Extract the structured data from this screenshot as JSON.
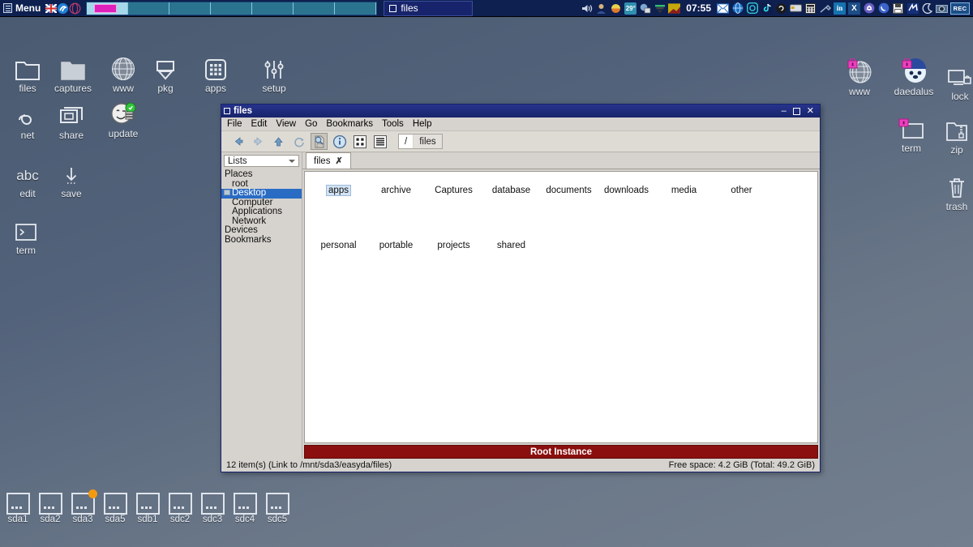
{
  "taskbar": {
    "menu_label": "Menu",
    "menu_icon": "menu-list-icon",
    "flag_icon": "uk-flag-icon",
    "browser_icon": "browser-globe-icon",
    "rings_icon": "rings-icon",
    "pager": {
      "cells": 7,
      "active_index": 0
    },
    "tasks": [
      {
        "label": "files",
        "icon": "window-square-icon",
        "active": true
      }
    ],
    "clock": "07:55",
    "tray_icons": [
      "volume-icon",
      "user-icon",
      "weather-sun-icon",
      "temperature-29-icon",
      "network-icon",
      "printer-icon",
      "disk-usage-icon"
    ],
    "tray_icons_right": [
      "mail-envelope-icon",
      "globe-browser-icon",
      "instagram-icon",
      "tiktok-icon",
      "amazon-icon",
      "card-icon",
      "calculator-icon",
      "tools-icon",
      "linkedin-icon",
      "x-twitter-icon",
      "openai-icon",
      "whatsapp-icon",
      "floppy-save-icon",
      "update-arrows-icon",
      "sleep-moon-icon",
      "camera-icon",
      "rec-icon"
    ],
    "temp_label": "29°",
    "rec_label": "REC"
  },
  "desktop_left": [
    {
      "label": "files",
      "icon": "folder-outline-icon"
    },
    {
      "label": "captures",
      "icon": "folder-filled-icon"
    },
    {
      "label": "www",
      "icon": "globe-sphere-icon"
    },
    {
      "label": "pkg",
      "icon": "package-download-icon"
    },
    {
      "label": "apps",
      "icon": "apps-grid-icon"
    },
    {
      "label": "setup",
      "icon": "sliders-settings-icon"
    },
    {
      "label": "net",
      "icon": "network-link-icon"
    },
    {
      "label": "share",
      "icon": "share-screen-icon"
    },
    {
      "label": "update",
      "icon": "update-smiley-icon"
    },
    {
      "label": "edit",
      "icon": "abc-text-icon"
    },
    {
      "label": "save",
      "icon": "download-arrow-icon"
    },
    {
      "label": "term",
      "icon": "terminal-prompt-icon"
    }
  ],
  "desktop_right": [
    {
      "label": "www",
      "icon": "globe-sphere-locked-icon"
    },
    {
      "label": "daedalus",
      "icon": "daedalus-dog-locked-icon"
    },
    {
      "label": "lock",
      "icon": "screen-lock-icon"
    },
    {
      "label": "term",
      "icon": "terminal-locked-icon"
    },
    {
      "label": "zip",
      "icon": "zip-folder-icon"
    },
    {
      "label": "trash",
      "icon": "trash-bin-icon"
    }
  ],
  "drives": [
    {
      "label": "sda1",
      "badge": false
    },
    {
      "label": "sda2",
      "badge": false
    },
    {
      "label": "sda3",
      "badge": true
    },
    {
      "label": "sda5",
      "badge": false
    },
    {
      "label": "sdb1",
      "badge": false
    },
    {
      "label": "sdc2",
      "badge": false
    },
    {
      "label": "sdc3",
      "badge": false
    },
    {
      "label": "sdc4",
      "badge": false
    },
    {
      "label": "sdc5",
      "badge": false
    }
  ],
  "file_manager": {
    "title": "files",
    "window_buttons": {
      "minimize": "–",
      "maximize": "maximize-icon",
      "close": "✕"
    },
    "menus": [
      "File",
      "Edit",
      "View",
      "Go",
      "Bookmarks",
      "Tools",
      "Help"
    ],
    "toolbar_icons": [
      "back-arrow-icon",
      "forward-arrow-icon",
      "up-arrow-icon",
      "refresh-icon",
      "preview-document-icon",
      "info-icon",
      "icon-view-icon",
      "list-view-icon"
    ],
    "path_segments": [
      "/",
      "files"
    ],
    "sidebar": {
      "combo_value": "Lists",
      "items": [
        {
          "label": "Places",
          "level": 0,
          "selected": false
        },
        {
          "label": "root",
          "level": 1,
          "selected": false
        },
        {
          "label": "Desktop",
          "level": 1,
          "selected": true
        },
        {
          "label": "Computer",
          "level": 1,
          "selected": false
        },
        {
          "label": "Applications",
          "level": 1,
          "selected": false
        },
        {
          "label": "Network",
          "level": 1,
          "selected": false
        },
        {
          "label": "Devices",
          "level": 0,
          "selected": false
        },
        {
          "label": "Bookmarks",
          "level": 0,
          "selected": false
        }
      ]
    },
    "tabs": [
      {
        "label": "files",
        "close": "✗",
        "active": true
      }
    ],
    "files": [
      {
        "name": "apps",
        "selected": true
      },
      {
        "name": "archive",
        "selected": false
      },
      {
        "name": "Captures",
        "selected": false
      },
      {
        "name": "database",
        "selected": false
      },
      {
        "name": "documents",
        "selected": false
      },
      {
        "name": "downloads",
        "selected": false
      },
      {
        "name": "media",
        "selected": false
      },
      {
        "name": "other",
        "selected": false
      },
      {
        "name": "personal",
        "selected": false
      },
      {
        "name": "portable",
        "selected": false
      },
      {
        "name": "projects",
        "selected": false
      },
      {
        "name": "shared",
        "selected": false
      }
    ],
    "root_banner": "Root Instance",
    "status_left": "12 item(s) (Link to /mnt/sda3/easyda/files)",
    "status_right": "Free space: 4.2 GiB (Total: 49.2 GiB)"
  },
  "colors": {
    "taskbar_bg": "#0d2050",
    "titlebar_bg": "#17246b",
    "selection_blue": "#2a6cc4",
    "root_banner_red": "#8b0f0f",
    "pager_active": "#a5d8ea",
    "pager_window": "#e020bb",
    "desktop_top": "#4a5a70",
    "desktop_bottom": "#737f8e"
  }
}
